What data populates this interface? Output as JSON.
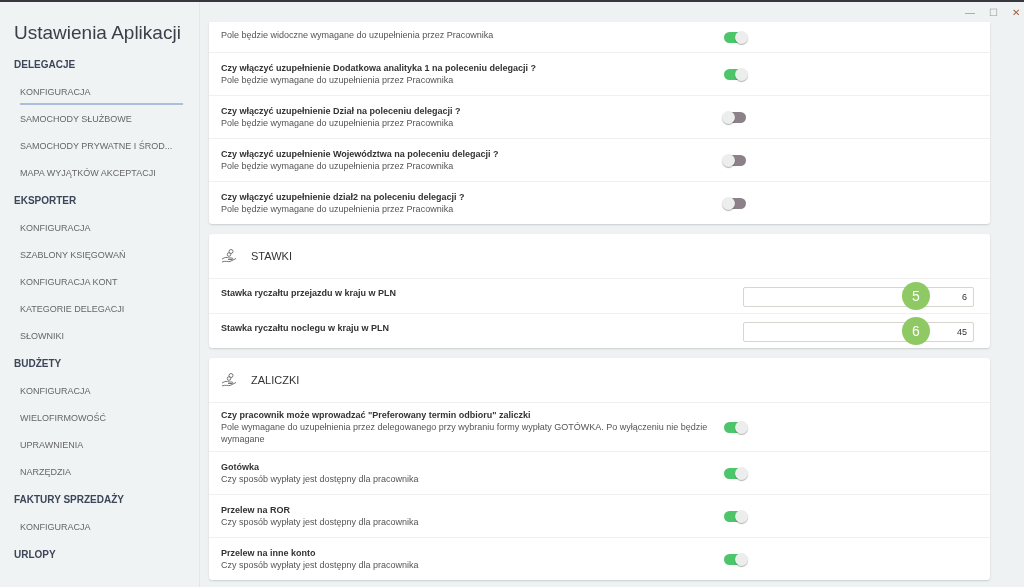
{
  "window": {
    "controls": [
      "—",
      "☐",
      "✕"
    ]
  },
  "sidebar": {
    "title": "Ustawienia Aplikacji",
    "sections": [
      {
        "label": "DELEGACJE",
        "items": [
          {
            "label": "KONFIGURACJA",
            "selected": true
          },
          {
            "label": "SAMOCHODY SŁUŻBOWE",
            "selected": false
          },
          {
            "label": "SAMOCHODY PRYWATNE I ŚROD...",
            "selected": false
          },
          {
            "label": "MAPA WYJĄTKÓW AKCEPTACJI",
            "selected": false
          }
        ]
      },
      {
        "label": "EKSPORTER",
        "items": [
          {
            "label": "KONFIGURACJA",
            "selected": false
          },
          {
            "label": "SZABLONY KSIĘGOWAŃ",
            "selected": false
          },
          {
            "label": "KONFIGURACJA KONT",
            "selected": false
          },
          {
            "label": "KATEGORIE DELEGACJI",
            "selected": false
          },
          {
            "label": "SŁOWNIKI",
            "selected": false
          }
        ]
      },
      {
        "label": "BUDŻETY",
        "items": [
          {
            "label": "KONFIGURACJA",
            "selected": false
          },
          {
            "label": "WIELOFIRMOWOŚĆ",
            "selected": false
          },
          {
            "label": "UPRAWNIENIA",
            "selected": false
          },
          {
            "label": "NARZĘDZIA",
            "selected": false
          }
        ]
      },
      {
        "label": "FAKTURY SPRZEDAŻY",
        "items": [
          {
            "label": "KONFIGURACJA",
            "selected": false
          }
        ]
      },
      {
        "label": "URLOPY"
      }
    ]
  },
  "cards": [
    {
      "rows": [
        {
          "kind": "toggle",
          "description": "Pole będzie widoczne wymagane do uzupełnienia przez Pracownika",
          "on": true
        },
        {
          "kind": "toggle",
          "title": "Czy włączyć uzupełnienie Dodatkowa analityka 1 na poleceniu delegacji ?",
          "description": "Pole będzie wymagane do uzupełnienia przez Pracownika",
          "on": true
        },
        {
          "kind": "toggle",
          "title": "Czy włączyć uzupełnienie Dział na poleceniu delegacji ?",
          "description": "Pole będzie wymagane do uzupełnienia przez Pracownika",
          "on": false
        },
        {
          "kind": "toggle",
          "title": "Czy włączyć uzupełnienie Województwa na poleceniu delegacji ?",
          "description": "Pole będzie wymagane do uzupełnienia przez Pracownika",
          "on": false
        },
        {
          "kind": "toggle",
          "title": "Czy włączyć uzupełnienie dział2 na poleceniu delegacji ?",
          "description": "Pole będzie wymagane do uzupełnienia przez Pracownika",
          "on": false
        }
      ]
    },
    {
      "title": "STAWKI",
      "rows": [
        {
          "kind": "input",
          "title": "Stawka ryczałtu przejazdu w kraju w PLN",
          "value": "6",
          "marker": "5"
        },
        {
          "kind": "input",
          "title": "Stawka ryczałtu noclegu w kraju w PLN",
          "value": "45",
          "marker": "6"
        }
      ]
    },
    {
      "title": "ZALICZKI",
      "rows": [
        {
          "kind": "toggle",
          "title": "Czy pracownik może wprowadzać \"Preferowany termin odbioru\" zaliczki",
          "description": "Pole wymagane do uzupełnienia przez delegowanego przy wybraniu formy wypłaty GOTÓWKA. Po wyłączeniu nie będzie wymagane",
          "on": true
        },
        {
          "kind": "toggle",
          "title": "Gotówka",
          "description": "Czy sposób wypłaty jest dostępny dla pracownika",
          "on": true
        },
        {
          "kind": "toggle",
          "title": "Przelew na ROR",
          "description": "Czy sposób wypłaty jest dostępny dla pracownika",
          "on": true
        },
        {
          "kind": "toggle",
          "title": "Przelew na inne konto",
          "description": "Czy sposób wypłaty jest dostępny dla pracownika",
          "on": true
        }
      ]
    }
  ]
}
